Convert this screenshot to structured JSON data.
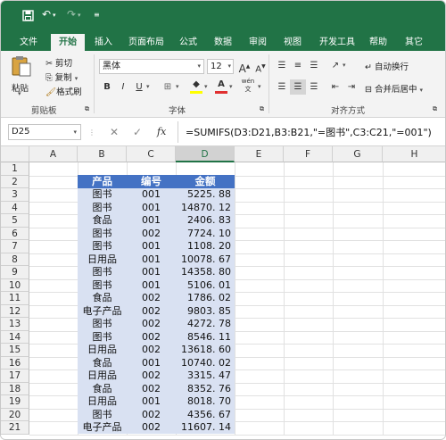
{
  "titlebar": {
    "save_icon": "save-icon",
    "undo_icon": "undo-icon",
    "redo_icon": "redo-icon",
    "customize_icon": "customize-icon"
  },
  "tabs": [
    "文件",
    "开始",
    "插入",
    "页面布局",
    "公式",
    "数据",
    "审阅",
    "视图",
    "开发工具",
    "帮助",
    "其它"
  ],
  "active_tab": "开始",
  "ribbon": {
    "clipboard": {
      "paste": "粘贴",
      "cut": "剪切",
      "copy": "复制",
      "format_painter": "格式刷",
      "group": "剪贴板"
    },
    "font": {
      "name": "黑体",
      "size": "12",
      "bold": "B",
      "italic": "I",
      "underline": "U",
      "grow": "A",
      "shrink": "A",
      "wen": "wén",
      "group": "字体"
    },
    "alignment": {
      "wrap": "自动换行",
      "merge": "合并后居中",
      "group": "对齐方式"
    }
  },
  "formula_bar": {
    "name_box": "D25",
    "fx": "fx",
    "formula": "=SUMIFS(D3:D21,B3:B21,\"=图书\",C3:C21,\"=001\")"
  },
  "columns": [
    "A",
    "B",
    "C",
    "D",
    "E",
    "F",
    "G",
    "H"
  ],
  "rows": [
    "1",
    "2",
    "3",
    "4",
    "5",
    "6",
    "7",
    "8",
    "9",
    "10",
    "11",
    "12",
    "13",
    "14",
    "15",
    "16",
    "17",
    "18",
    "19",
    "20",
    "21"
  ],
  "table": {
    "headers": [
      "产品",
      "编号",
      "金额"
    ],
    "rows": [
      [
        "图书",
        "001",
        "5225. 88"
      ],
      [
        "图书",
        "001",
        "14870. 12"
      ],
      [
        "食品",
        "001",
        "2406. 83"
      ],
      [
        "图书",
        "002",
        "7724. 10"
      ],
      [
        "图书",
        "001",
        "1108. 20"
      ],
      [
        "日用品",
        "001",
        "10078. 67"
      ],
      [
        "图书",
        "001",
        "14358. 80"
      ],
      [
        "图书",
        "001",
        "5106. 01"
      ],
      [
        "食品",
        "002",
        "1786. 02"
      ],
      [
        "电子产品",
        "002",
        "9803. 85"
      ],
      [
        "图书",
        "002",
        "4272. 78"
      ],
      [
        "图书",
        "002",
        "8546. 11"
      ],
      [
        "日用品",
        "002",
        "13618. 60"
      ],
      [
        "食品",
        "001",
        "10740. 02"
      ],
      [
        "日用品",
        "002",
        "3315. 47"
      ],
      [
        "食品",
        "002",
        "8352. 76"
      ],
      [
        "日用品",
        "001",
        "8018. 70"
      ],
      [
        "图书",
        "002",
        "4356. 67"
      ],
      [
        "电子产品",
        "002",
        "11607. 14"
      ]
    ]
  },
  "colors": {
    "excel_green": "#217346",
    "header_blue": "#4472c4",
    "band_light": "#d9e1f2"
  }
}
